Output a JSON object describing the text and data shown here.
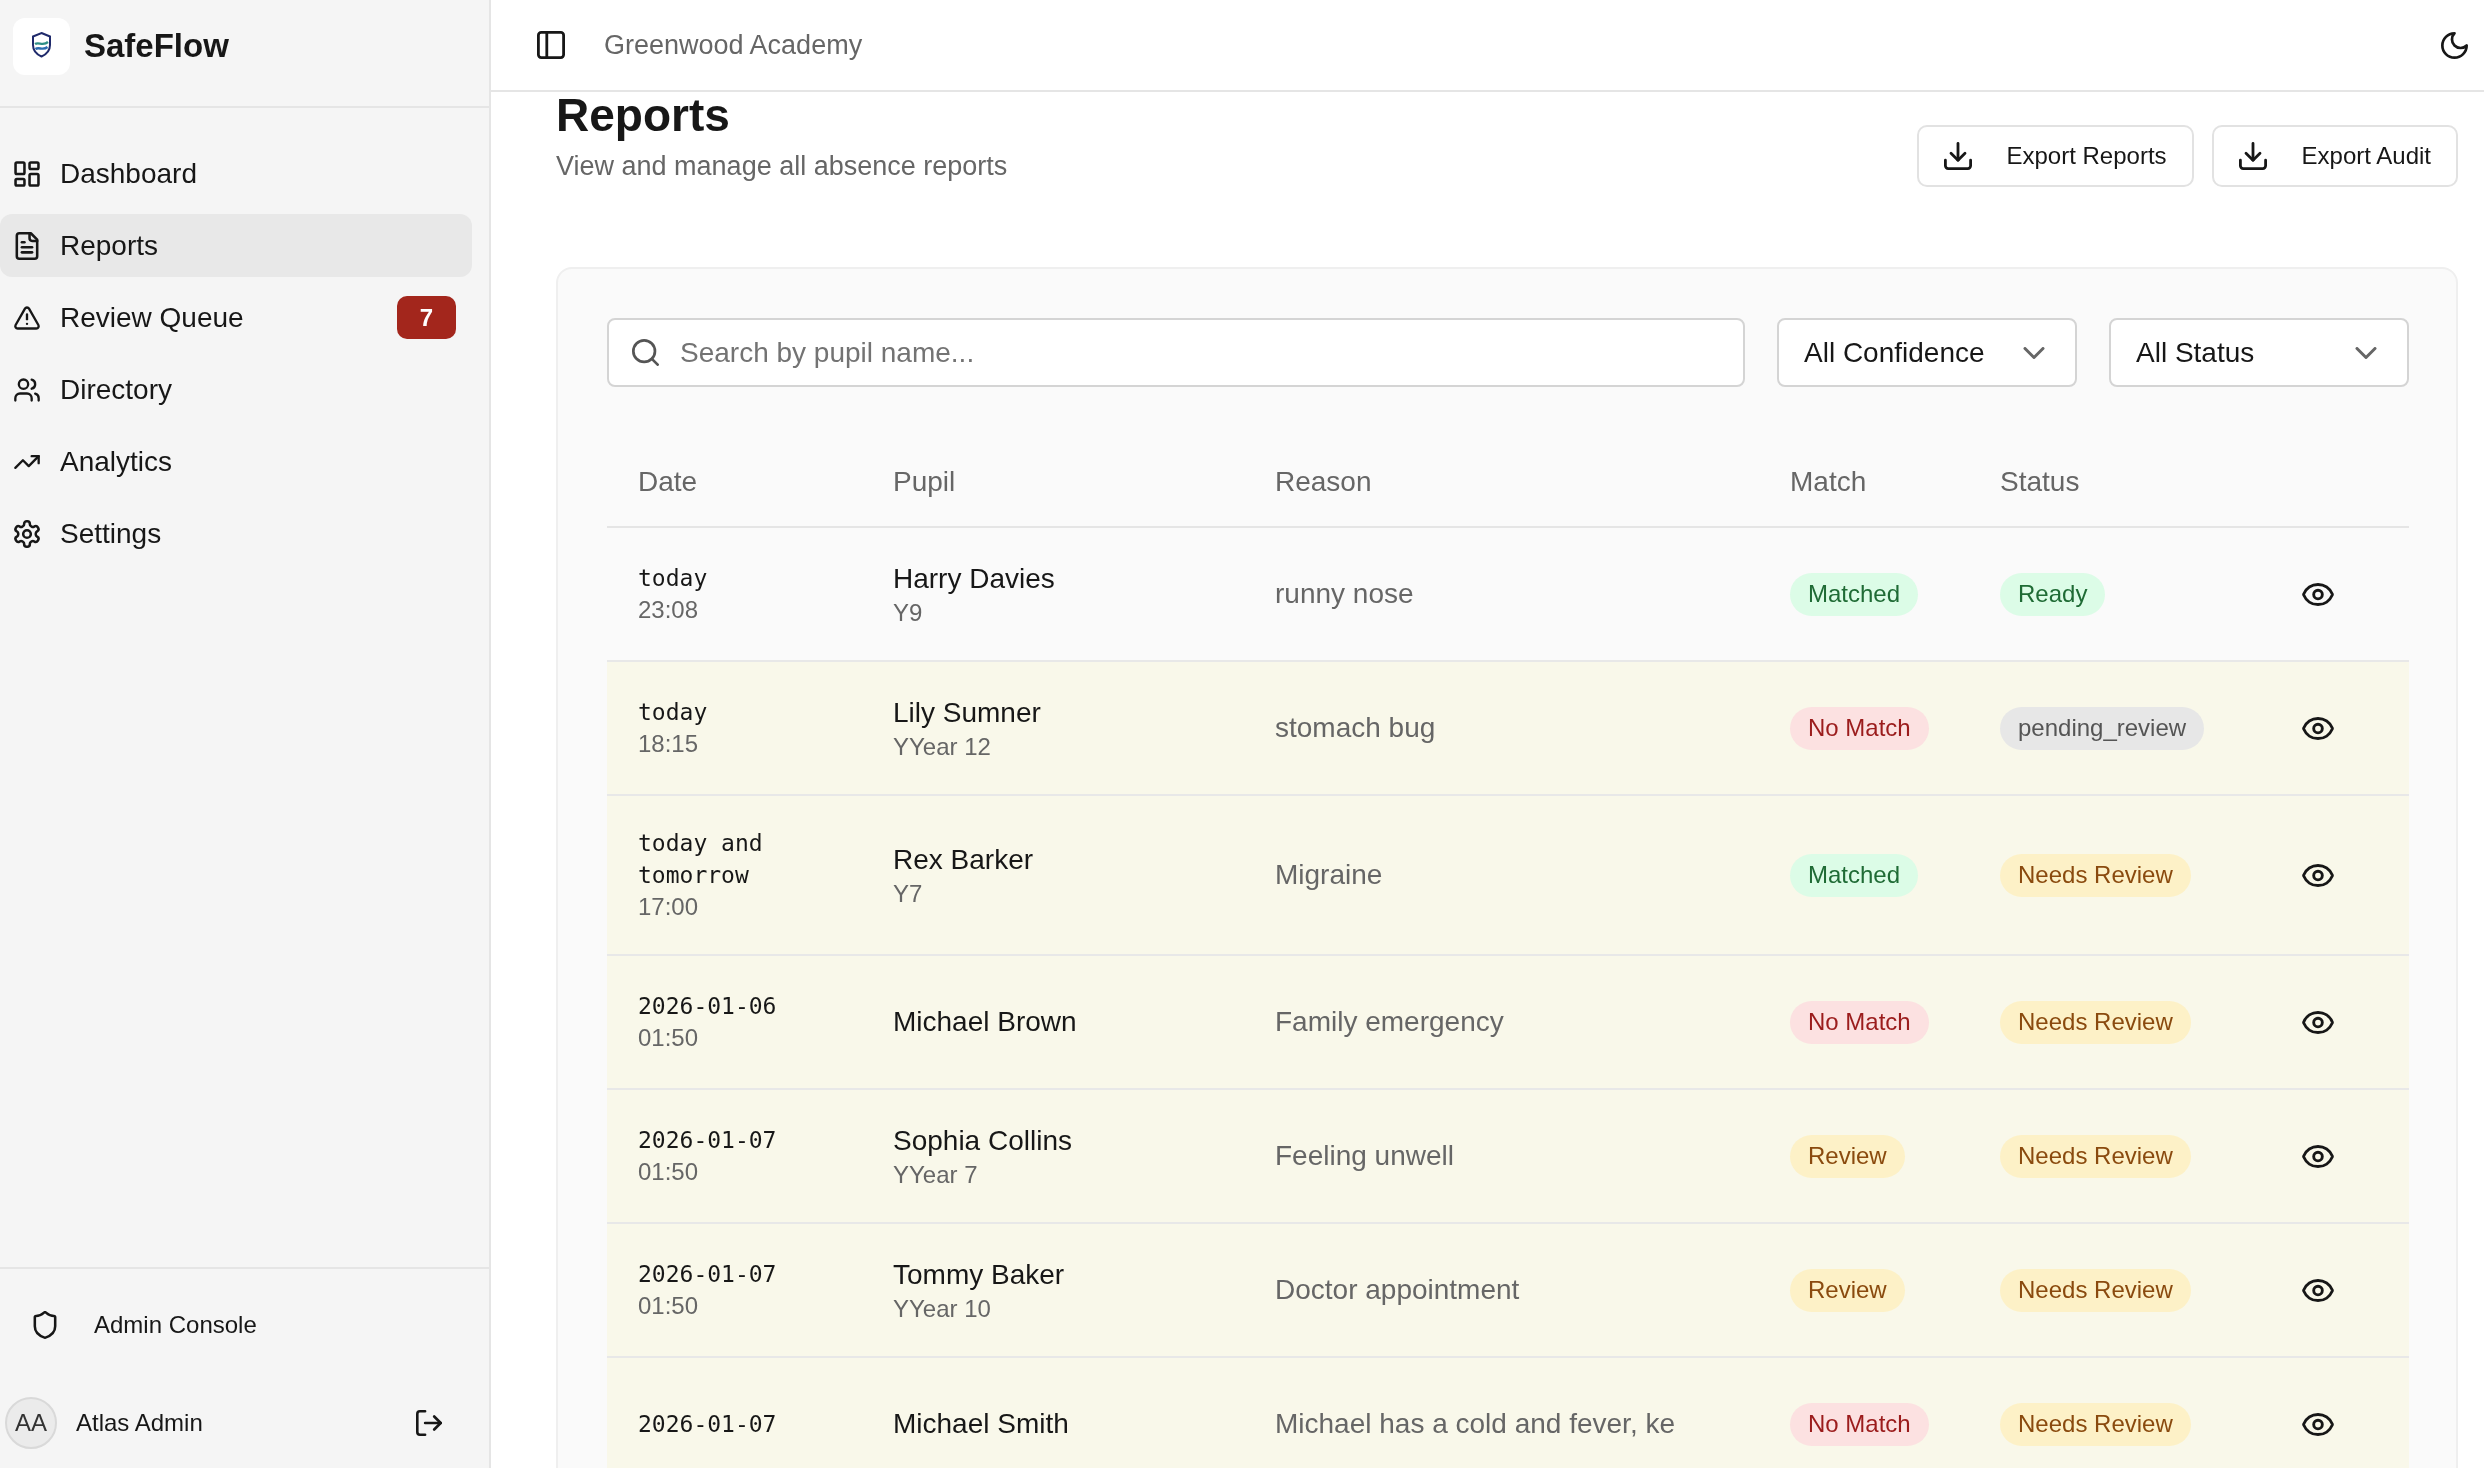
{
  "sidebar": {
    "brand": "SafeFlow",
    "nav": [
      {
        "label": "Dashboard",
        "selected": false
      },
      {
        "label": "Reports",
        "selected": true
      },
      {
        "label": "Review Queue",
        "selected": false,
        "badge": "7"
      },
      {
        "label": "Directory",
        "selected": false
      },
      {
        "label": "Analytics",
        "selected": false
      },
      {
        "label": "Settings",
        "selected": false
      }
    ],
    "admin_link": "Admin Console",
    "user": {
      "initials": "AA",
      "name": "Atlas Admin"
    }
  },
  "header": {
    "school": "Greenwood Academy"
  },
  "page": {
    "title": "Reports",
    "subtitle": "View and manage all absence reports",
    "actions": [
      "Export Reports",
      "Export Audit"
    ]
  },
  "filters": {
    "search": {
      "placeholder": "Search by pupil name..."
    },
    "dropdowns": [
      "All Confidence",
      "All Status"
    ]
  },
  "table": {
    "columns": [
      "Date",
      "Pupil",
      "Reason",
      "Match",
      "Status"
    ],
    "rows": [
      {
        "date": "today",
        "time": "23:08",
        "pupil": "Harry Davies",
        "year": "Y9",
        "reason": "runny nose",
        "match": {
          "label": "Matched",
          "kind": "success"
        },
        "status": {
          "label": "Ready",
          "kind": "success"
        },
        "highlighted": false
      },
      {
        "date": "today",
        "time": "18:15",
        "pupil": "Lily Sumner",
        "year": "YYear 12",
        "reason": "stomach bug",
        "match": {
          "label": "No Match",
          "kind": "danger"
        },
        "status": {
          "label": "pending_review",
          "kind": "neutral"
        },
        "highlighted": true
      },
      {
        "date": "today and tomorrow",
        "time": "17:00",
        "pupil": "Rex Barker",
        "year": "Y7",
        "reason": "Migraine",
        "match": {
          "label": "Matched",
          "kind": "success"
        },
        "status": {
          "label": "Needs Review",
          "kind": "warning"
        },
        "highlighted": true
      },
      {
        "date": "2026-01-06",
        "time": "01:50",
        "pupil": "Michael Brown",
        "reason": "Family emergency",
        "match": {
          "label": "No Match",
          "kind": "danger"
        },
        "status": {
          "label": "Needs Review",
          "kind": "warning"
        },
        "highlighted": true
      },
      {
        "date": "2026-01-07",
        "time": "01:50",
        "pupil": "Sophia Collins",
        "year": "YYear 7",
        "reason": "Feeling unwell",
        "match": {
          "label": "Review",
          "kind": "warning"
        },
        "status": {
          "label": "Needs Review",
          "kind": "warning"
        },
        "highlighted": true
      },
      {
        "date": "2026-01-07",
        "time": "01:50",
        "pupil": "Tommy Baker",
        "year": "YYear 10",
        "reason": "Doctor appointment",
        "match": {
          "label": "Review",
          "kind": "warning"
        },
        "status": {
          "label": "Needs Review",
          "kind": "warning"
        },
        "highlighted": true
      },
      {
        "date": "2026-01-07",
        "pupil": "Michael Smith",
        "reason": "Michael has a cold and fever, ke",
        "match": {
          "label": "No Match",
          "kind": "danger"
        },
        "status": {
          "label": "Needs Review",
          "kind": "warning"
        },
        "highlighted": true
      }
    ]
  }
}
